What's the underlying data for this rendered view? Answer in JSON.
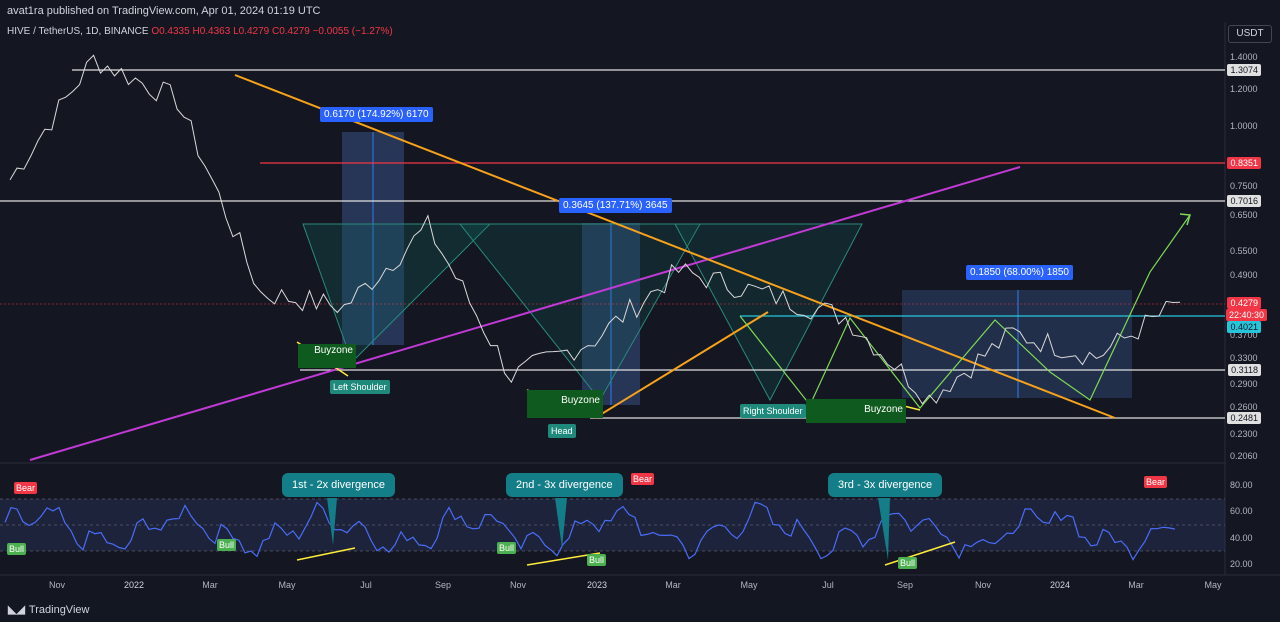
{
  "header": {
    "published": "avat1ra published on TradingView.com, Apr 01, 2024 01:19 UTC",
    "symbol": "HIVE / TetherUS, 1D, BINANCE",
    "o": "O0.4335",
    "h": "H0.4363",
    "l": "L0.4279",
    "c": "C0.4279",
    "chg": "−0.0055 (−1.27%)"
  },
  "currency": "USDT",
  "price_ticks": [
    "1.4000",
    "1.2000",
    "1.0000",
    "0.7500",
    "0.6500",
    "0.5500",
    "0.4900",
    "0.3700",
    "0.3300",
    "0.2900",
    "0.2600",
    "0.2300",
    "0.2060"
  ],
  "price_labels": {
    "l1": "1.3074",
    "l2": "0.8351",
    "l3": "0.7016",
    "last": "0.4279",
    "timer": "22:40:30",
    "l4": "0.4021",
    "l5": "0.3118",
    "l6": "0.2481"
  },
  "rsi_ticks": [
    "80.00",
    "60.00",
    "40.00",
    "20.00"
  ],
  "x_ticks": [
    "Nov",
    "2022",
    "Mar",
    "May",
    "Jul",
    "Sep",
    "Nov",
    "2023",
    "Mar",
    "May",
    "Jul",
    "Sep",
    "Nov",
    "2024",
    "Mar",
    "May"
  ],
  "annotations": {
    "m1": "0.6170 (174.92%) 6170",
    "m2": "0.3645 (137.71%) 3645",
    "m3": "0.1850 (68.00%) 1850",
    "buyzone1": "Buyzone",
    "buyzone2": "Buyzone",
    "buyzone3": "Buyzone",
    "left_shoulder": "Left Shoulder",
    "head": "Head",
    "right_shoulder": "Right Shoulder",
    "div1": "1st - 2x divergence",
    "div2": "2nd - 3x divergence",
    "div3": "3rd - 3x divergence",
    "bear": "Bear",
    "bull": "Bull"
  },
  "footer": {
    "brand": "TradingView"
  },
  "chart_data": {
    "type": "line",
    "x": [
      "2021-11",
      "2022-01",
      "2022-03",
      "2022-05",
      "2022-07",
      "2022-09",
      "2022-11",
      "2023-01",
      "2023-03",
      "2023-05",
      "2023-07",
      "2023-09",
      "2023-11",
      "2024-01",
      "2024-03"
    ],
    "series": [
      {
        "values": [
          0.78,
          1.4,
          1.15,
          0.45,
          0.42,
          0.62,
          0.3,
          0.36,
          0.5,
          0.45,
          0.4,
          0.27,
          0.37,
          0.33,
          0.43
        ]
      }
    ],
    "horizontal_levels": [
      1.3074,
      0.8351,
      0.7016,
      0.4021,
      0.3118,
      0.2481
    ],
    "last_price": 0.4279,
    "y_scale": "log",
    "ylim": [
      0.2,
      1.5
    ]
  }
}
